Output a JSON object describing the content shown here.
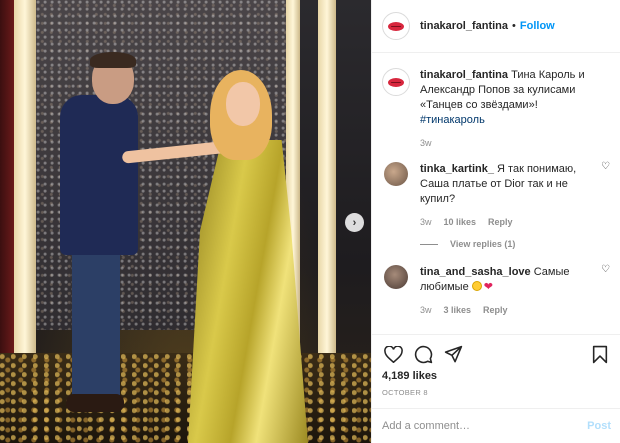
{
  "header": {
    "username": "tinakarol_fantina",
    "separator": "•",
    "follow_label": "Follow"
  },
  "caption": {
    "username": "tinakarol_fantina",
    "text": "Тина Кароль и Александр Попов за кулисами «Танцев со звёздами»!",
    "hashtag": "#тинакароль",
    "time": "3w"
  },
  "comments": [
    {
      "username": "tinka_kartink_",
      "text": "Я так понимаю, Саша платье от Dior так и не купил?",
      "time": "3w",
      "likes": "10 likes",
      "reply_label": "Reply",
      "view_replies": "View replies (1)"
    },
    {
      "username": "tina_and_sasha_love",
      "text": "Самые любимые",
      "time": "3w",
      "likes": "3 likes",
      "reply_label": "Reply"
    }
  ],
  "actions": {
    "likes_count": "4,189 likes",
    "date": "OCTOBER 8"
  },
  "add_comment": {
    "placeholder": "Add a comment…",
    "post_label": "Post"
  },
  "colors": {
    "accent_blue": "#0095f6",
    "post_disabled": "#b2dffc",
    "secondary_text": "#8e8e8e",
    "hashtag": "#00376b"
  }
}
